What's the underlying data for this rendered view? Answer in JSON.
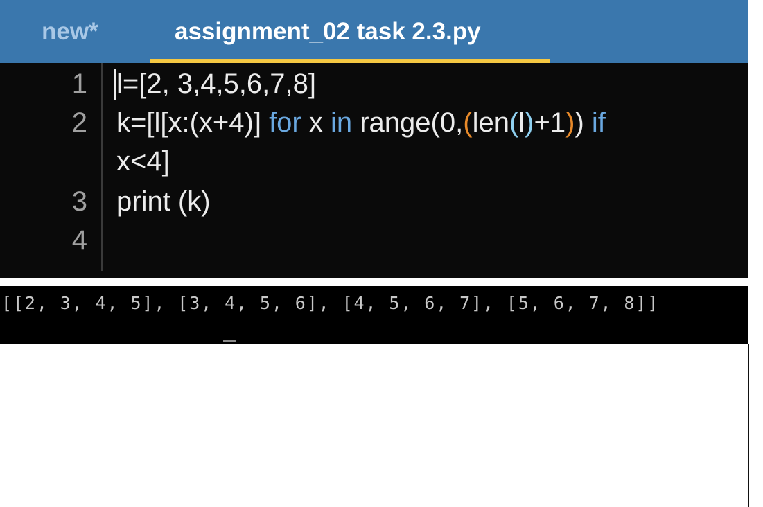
{
  "tabs": [
    {
      "label": "new*",
      "active": false
    },
    {
      "label": "assignment_02 task 2.3.py",
      "active": true
    }
  ],
  "editor": {
    "line_numbers": [
      "1",
      "2",
      "3",
      "4"
    ],
    "lines": {
      "l1": "l=[2, 3,4,5,6,7,8]",
      "l2a": "k=[l[x:(x+4)] ",
      "l2_for": "for",
      "l2b": " x ",
      "l2_in": "in",
      "l2c": " range(0,",
      "l2_p1o": "(",
      "l2_len": "len",
      "l2_p2o": "(",
      "l2_l": "l",
      "l2_p2c": ")",
      "l2_plus": "+1",
      "l2_p1c": ")",
      "l2_close": ") ",
      "l2_if": "if",
      "l2_wrap": "x<4]",
      "l3": "print (k)",
      "l4": ""
    }
  },
  "console": {
    "output": "[[2, 3, 4, 5], [3, 4, 5, 6], [4, 5, 6, 7], [5, 6, 7, 8]]"
  },
  "colors": {
    "tabbar": "#3a77ad",
    "active_underline": "#f5c842",
    "keyword": "#6aa8e0",
    "paren_outer": "#e88a2a",
    "paren_inner": "#8fd0f0"
  }
}
